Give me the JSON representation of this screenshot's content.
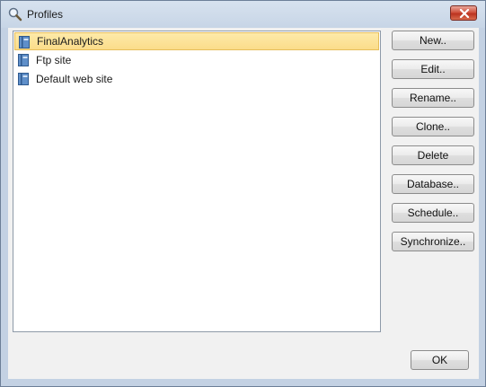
{
  "window": {
    "title": "Profiles",
    "title_icon": "magnifier-icon",
    "close_icon": "close-icon"
  },
  "profiles": [
    {
      "label": "FinalAnalytics",
      "icon": "profile-book-icon",
      "selected": true
    },
    {
      "label": "Ftp site",
      "icon": "profile-book-icon",
      "selected": false
    },
    {
      "label": "Default web site",
      "icon": "profile-book-icon",
      "selected": false
    }
  ],
  "actions": {
    "new": "New..",
    "edit": "Edit..",
    "rename": "Rename..",
    "clone": "Clone..",
    "delete": "Delete",
    "database": "Database..",
    "schedule": "Schedule..",
    "synchronize": "Synchronize.."
  },
  "footer": {
    "ok": "OK"
  },
  "colors": {
    "selection_fill": "#fbdc8a",
    "selection_border": "#e6be5a",
    "close_red": "#c9432d",
    "frame": "#c3d1e3"
  }
}
